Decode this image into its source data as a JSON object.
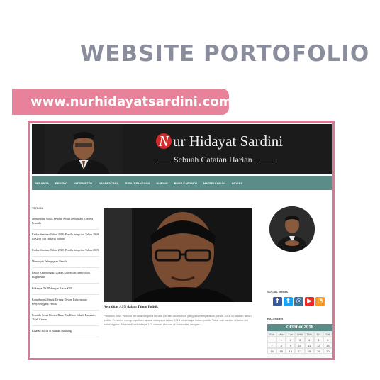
{
  "heading": "WEBSITE PORTOFOLIO",
  "url": "www.nurhidayatsardini.com",
  "site": {
    "logo_letter": "N",
    "name_rest": "ur Hidayat Sardini",
    "tagline": "Sebuah Catatan Harian"
  },
  "nav": [
    "BERANDA",
    "REKENO",
    "INTERMEZZO",
    "NAVAWACARA",
    "SUDUT PANDANG",
    "KLIPING",
    "BUKU KARYAKU",
    "MATERI KULIAH",
    "INDEKS"
  ],
  "sidebar": {
    "heading": "TERKINI",
    "posts": [
      "Mengenang Sosok Pendiri, Ketua Organisasi Kongres Pemuda",
      "Kedua Seminar Tahun 2018: Pemilu Integritas Tahun 2019 (DKPP) Nur Hidayat Sardini",
      "Kedua Seminar Tahun 2018: Pemilu Integritas Tahun 2019",
      "Mencegah Pelanggaran Pemilu",
      "Lewat Kebohongan, Ujaran Kebencian, dan Politik Plagiarisme",
      "Etikanya DKPP dengan Ketua KPU",
      "Konsekuensi Sepak Terjang Dewan Kehormatan Penyelenggara Pemilu",
      "Pemuda Serua Biwara Baru, Ela Kimo Sekali: Purwarto Tidak Cemas",
      "Kisaran Bocor di Jalanan Bandung"
    ]
  },
  "article": {
    "title": "Netralitas ASN dalam Tahun Politik",
    "excerpt": "Presiden Joko Widodo di hadapan para kepala daerah awal tahun yang lalu menyatakan, tahun 2018 ini adalah tahun politik. Presiden mengumpulkan aparat mengapa tahun 2018 ini sebagai tahun politik. Tidak lain karena di tahun ini bakal digelar Pilkada di setidaknya 171 daerah otonom di Indonesia, dengan ..."
  },
  "right_sidebar": {
    "social_label": "SOCIAL MEDIA",
    "social_icons": [
      {
        "name": "facebook-icon",
        "glyph": "f",
        "color": "#3b5998"
      },
      {
        "name": "twitter-icon",
        "glyph": "t",
        "color": "#1da1f2"
      },
      {
        "name": "instagram-icon",
        "glyph": "◎",
        "color": "#3f729b"
      },
      {
        "name": "youtube-icon",
        "glyph": "▶",
        "color": "#e52d27"
      },
      {
        "name": "rss-icon",
        "glyph": "◔",
        "color": "#f99a1c"
      }
    ],
    "calendar_label": "KALENDER",
    "calendar": {
      "month": "Oktober 2018",
      "days": [
        "Sun",
        "Mon",
        "Tue",
        "Wed",
        "Thu",
        "Fri",
        "Sat"
      ],
      "cells": [
        "",
        "1",
        "2",
        "3",
        "4",
        "5",
        "6",
        "7",
        "8",
        "9",
        "10",
        "11",
        "12",
        "13",
        "14",
        "15",
        "16",
        "17",
        "18",
        "19",
        "20"
      ]
    }
  },
  "colors": {
    "accent": "#e8829a",
    "frame": "#d97a95",
    "nav": "#5b8c87",
    "heading": "#8a8d9c"
  }
}
